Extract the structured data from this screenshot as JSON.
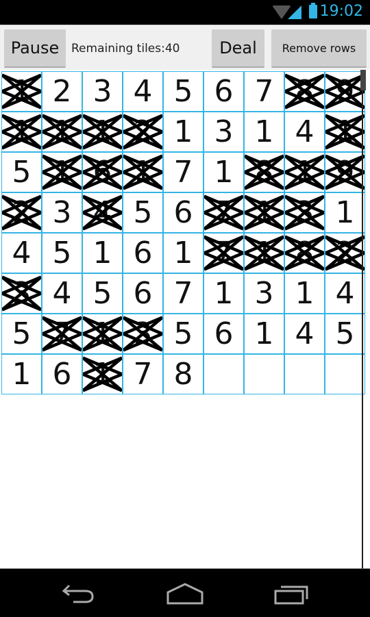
{
  "status_bar": {
    "time": "19:02",
    "icons": [
      "wifi-icon",
      "signal-icon",
      "battery-icon"
    ],
    "accent_color": "#33b5e5"
  },
  "toolbar": {
    "pause_label": "Pause",
    "remaining_text": "Remaining tiles:40",
    "deal_label": "Deal",
    "remove_rows_label": "Remove rows"
  },
  "board": {
    "columns": 9,
    "grid_color": "#33b5e5",
    "rows": [
      [
        {
          "v": "1",
          "x": true
        },
        {
          "v": "2",
          "x": false
        },
        {
          "v": "3",
          "x": false
        },
        {
          "v": "4",
          "x": false
        },
        {
          "v": "5",
          "x": false
        },
        {
          "v": "6",
          "x": false
        },
        {
          "v": "7",
          "x": false
        },
        {
          "v": "8",
          "x": true
        },
        {
          "v": "9",
          "x": true
        }
      ],
      [
        {
          "v": "1",
          "x": true
        },
        {
          "v": "1",
          "x": true
        },
        {
          "v": "1",
          "x": true
        },
        {
          "v": "2",
          "x": true
        },
        {
          "v": "1",
          "x": false
        },
        {
          "v": "3",
          "x": false
        },
        {
          "v": "1",
          "x": false
        },
        {
          "v": "4",
          "x": false
        },
        {
          "v": "1",
          "x": true
        }
      ],
      [
        {
          "v": "5",
          "x": false
        },
        {
          "v": "1",
          "x": true
        },
        {
          "v": "6",
          "x": true
        },
        {
          "v": "1",
          "x": true
        },
        {
          "v": "7",
          "x": false
        },
        {
          "v": "1",
          "x": false
        },
        {
          "v": "8",
          "x": true
        },
        {
          "v": "1",
          "x": true
        },
        {
          "v": "9",
          "x": true
        }
      ],
      [
        {
          "v": "2",
          "x": true
        },
        {
          "v": "3",
          "x": false
        },
        {
          "v": "4",
          "x": true
        },
        {
          "v": "5",
          "x": false
        },
        {
          "v": "6",
          "x": false
        },
        {
          "v": "7",
          "x": true
        },
        {
          "v": "1",
          "x": true
        },
        {
          "v": "3",
          "x": true
        },
        {
          "v": "1",
          "x": false
        }
      ],
      [
        {
          "v": "4",
          "x": false
        },
        {
          "v": "5",
          "x": false
        },
        {
          "v": "1",
          "x": false
        },
        {
          "v": "6",
          "x": false
        },
        {
          "v": "1",
          "x": false
        },
        {
          "v": "7",
          "x": true
        },
        {
          "v": "1",
          "x": true
        },
        {
          "v": "8",
          "x": true
        },
        {
          "v": "2",
          "x": true
        }
      ],
      [
        {
          "v": "3",
          "x": true
        },
        {
          "v": "4",
          "x": false
        },
        {
          "v": "5",
          "x": false
        },
        {
          "v": "6",
          "x": false
        },
        {
          "v": "7",
          "x": false
        },
        {
          "v": "1",
          "x": false
        },
        {
          "v": "3",
          "x": false
        },
        {
          "v": "1",
          "x": false
        },
        {
          "v": "4",
          "x": false
        }
      ],
      [
        {
          "v": "5",
          "x": false
        },
        {
          "v": "7",
          "x": true
        },
        {
          "v": "1",
          "x": true
        },
        {
          "v": "3",
          "x": true
        },
        {
          "v": "5",
          "x": false
        },
        {
          "v": "6",
          "x": false
        },
        {
          "v": "1",
          "x": false
        },
        {
          "v": "4",
          "x": false
        },
        {
          "v": "5",
          "x": false
        }
      ],
      [
        {
          "v": "1",
          "x": false
        },
        {
          "v": "6",
          "x": false
        },
        {
          "v": "1",
          "x": true
        },
        {
          "v": "7",
          "x": false
        },
        {
          "v": "8",
          "x": false
        },
        {
          "v": "",
          "x": false
        },
        {
          "v": "",
          "x": false
        },
        {
          "v": "",
          "x": false
        },
        {
          "v": "",
          "x": false
        }
      ]
    ]
  },
  "nav_bar": {
    "buttons": [
      "back-icon",
      "home-icon",
      "recents-icon"
    ]
  }
}
